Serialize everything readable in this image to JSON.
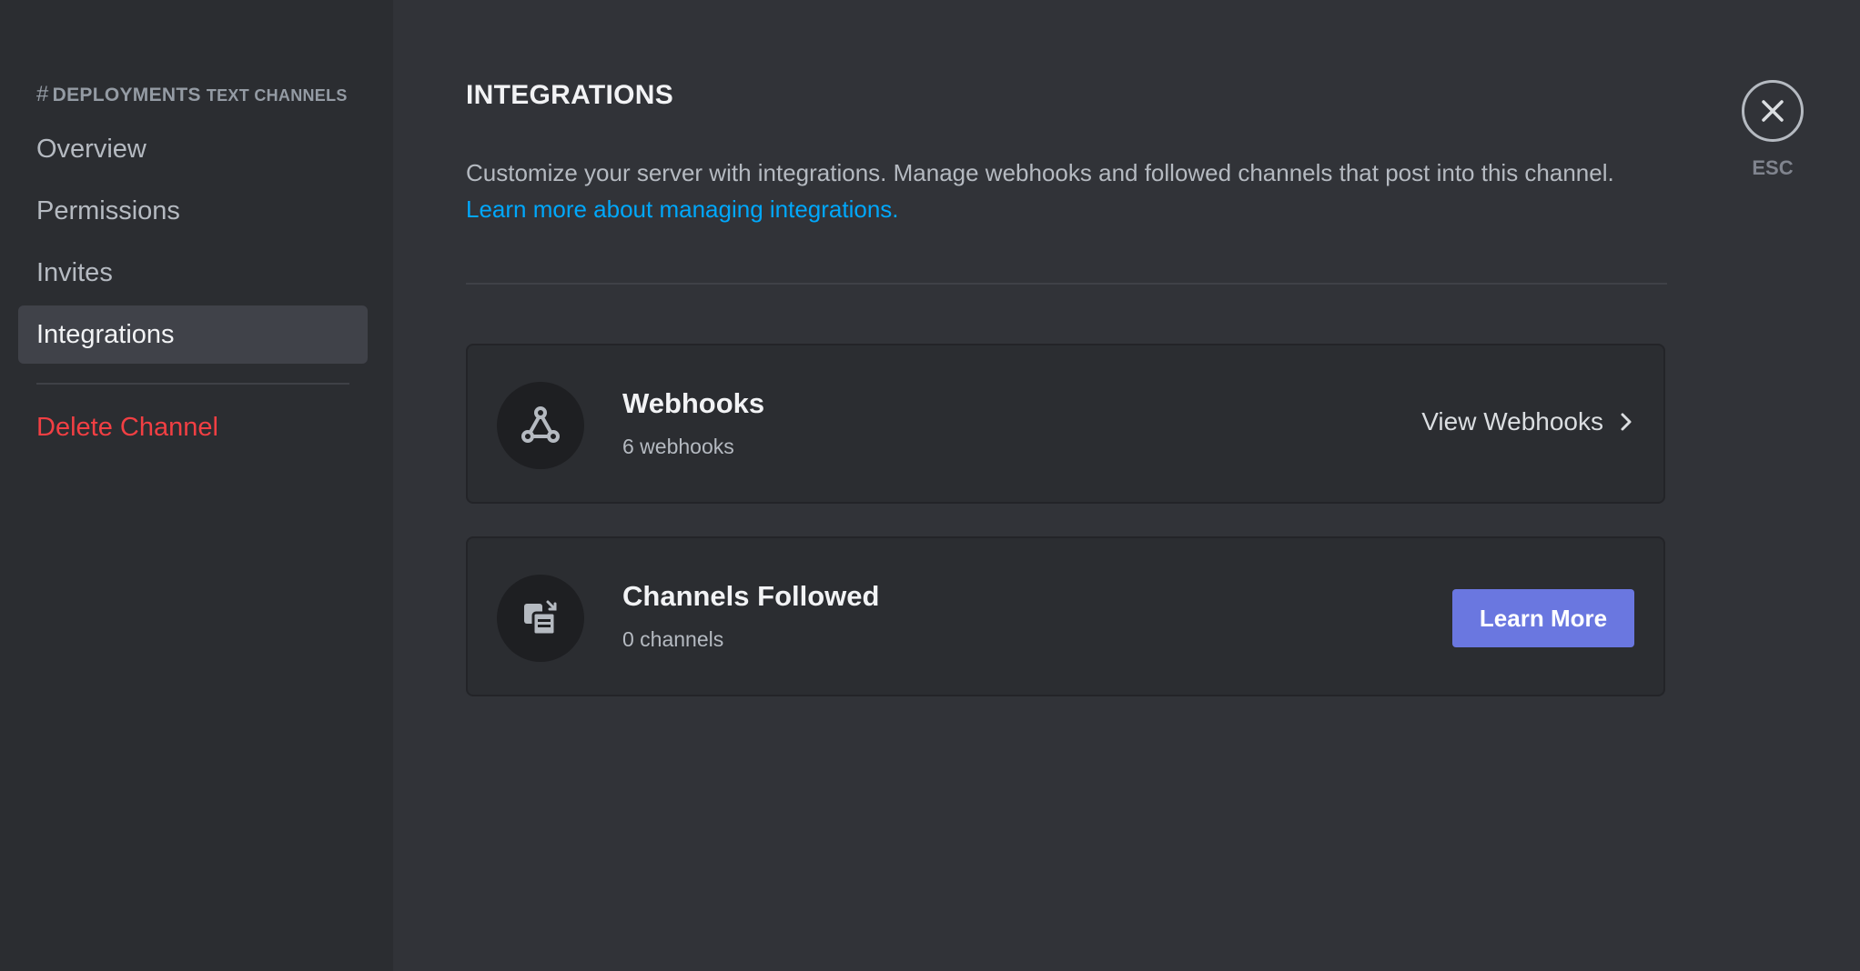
{
  "sidebar": {
    "channel_name": "DEPLOYMENTS",
    "channel_type": "TEXT CHANNELS",
    "items": [
      {
        "label": "Overview"
      },
      {
        "label": "Permissions"
      },
      {
        "label": "Invites"
      },
      {
        "label": "Integrations"
      }
    ],
    "delete_label": "Delete Channel",
    "active_item": "Integrations"
  },
  "main": {
    "title": "INTEGRATIONS",
    "description": "Customize your server with integrations. Manage webhooks and followed channels that post into this channel.",
    "learn_link": "Learn more about managing integrations.",
    "webhooks": {
      "title": "Webhooks",
      "count": "6 webhooks",
      "action": "View Webhooks",
      "icon": "webhook-icon"
    },
    "followed": {
      "title": "Channels Followed",
      "count": "0 channels",
      "action": "Learn More",
      "icon": "channel-follow-icon"
    }
  },
  "close": {
    "label": "ESC",
    "icon": "close-icon"
  },
  "colors": {
    "sidebar_bg": "#2b2d31",
    "main_bg": "#313338",
    "danger": "#f23f43",
    "link": "#00a8fc",
    "button": "#6a77e0"
  }
}
